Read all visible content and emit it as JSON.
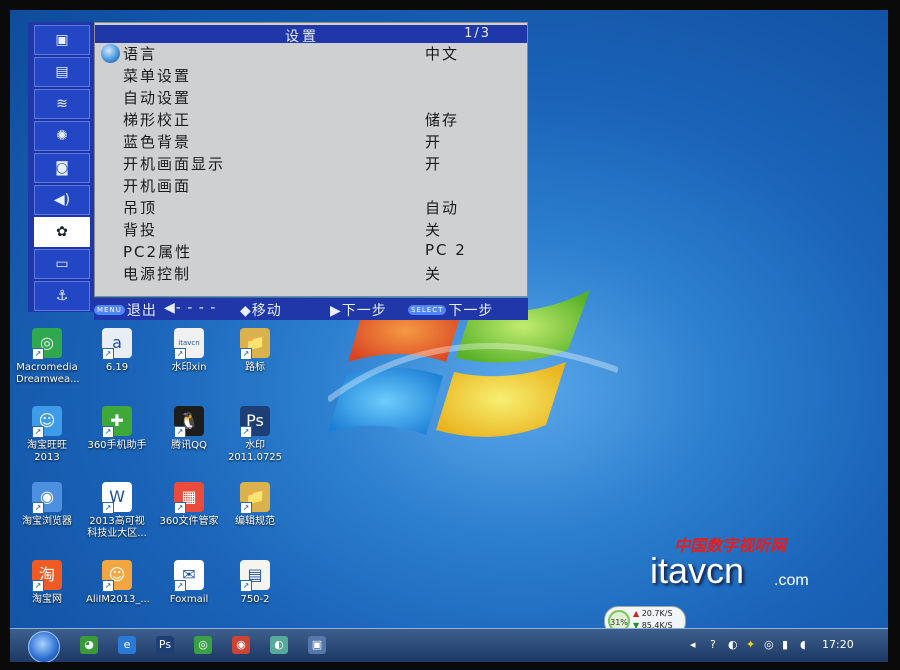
{
  "osd": {
    "title": "设置",
    "page": "1/3",
    "side_icons": [
      "image-icon",
      "display-icon",
      "waveform-icon",
      "brightness-icon",
      "projector-icon",
      "speaker-icon",
      "gear-icon",
      "monitor-icon",
      "anchor-icon"
    ],
    "active_index": 6,
    "menu": [
      {
        "label": "语言",
        "value": "中文"
      },
      {
        "label": "菜单设置",
        "value": ""
      },
      {
        "label": "自动设置",
        "value": ""
      },
      {
        "label": "梯形校正",
        "value": "储存"
      },
      {
        "label": "蓝色背景",
        "value": "开"
      },
      {
        "label": "开机画面显示",
        "value": "开"
      },
      {
        "label": "开机画面",
        "value": ""
      },
      {
        "label": "吊顶",
        "value": "自动"
      },
      {
        "label": "背投",
        "value": "关"
      },
      {
        "label": "PC2属性",
        "value": "PC 2"
      },
      {
        "label": "电源控制",
        "value": "关"
      }
    ],
    "footer": {
      "menu_btn": "MENU",
      "exit": "退出",
      "left": "◀- - - -",
      "move": "◆移动",
      "next_arrow": "▶下一步",
      "select_btn": "SELECT",
      "next2": "下一步"
    }
  },
  "desktop": {
    "icons": [
      {
        "label": "Macromedia Dreamwea...",
        "color": "#2fa84f",
        "glyph": "◎"
      },
      {
        "label": "6.19",
        "color": "#e9eef5",
        "glyph": "a"
      },
      {
        "label": "水印xin",
        "color": "#f1f1f1",
        "glyph": "itavcn"
      },
      {
        "label": "路标",
        "color": "#d9b24e",
        "glyph": "📁"
      },
      {
        "label": "淘宝旺旺 2013",
        "color": "#3e9be8",
        "glyph": "☺"
      },
      {
        "label": "360手机助手",
        "color": "#3fa83a",
        "glyph": "✚"
      },
      {
        "label": "腾讯QQ",
        "color": "#1d1d1d",
        "glyph": "🐧"
      },
      {
        "label": "水印 2011.0725",
        "color": "#1d3f75",
        "glyph": "Ps"
      },
      {
        "label": "淘宝浏览器",
        "color": "#4d90e0",
        "glyph": "◉"
      },
      {
        "label": "2013高可视 科技业大区...",
        "color": "#ffffff",
        "glyph": "W"
      },
      {
        "label": "360文件管家",
        "color": "#e94c3c",
        "glyph": "▦"
      },
      {
        "label": "编辑规范",
        "color": "#d9b24e",
        "glyph": "📁"
      },
      {
        "label": "淘宝网",
        "color": "#f05a24",
        "glyph": "淘"
      },
      {
        "label": "AliIM2013_...",
        "color": "#f3a640",
        "glyph": "☺"
      },
      {
        "label": "Foxmail",
        "color": "#ffffff",
        "glyph": "✉"
      },
      {
        "label": "750-2",
        "color": "#f5f5f0",
        "glyph": "▤"
      }
    ]
  },
  "watermark": {
    "cn": "中国数字视听网",
    "main": "itavcn",
    "dot": ".com"
  },
  "netmeter": {
    "percent": "31%",
    "up": "20.7K/S",
    "down": "85.4K/S"
  },
  "taskbar": {
    "pinned": [
      {
        "name": "360-browser-icon",
        "glyph": "◕",
        "color": "#3a9a3a"
      },
      {
        "name": "ie-icon",
        "glyph": "e",
        "color": "#2b7ad8"
      },
      {
        "name": "photoshop-icon",
        "glyph": "Ps",
        "color": "#1d3f75"
      },
      {
        "name": "360-safe-icon",
        "glyph": "◎",
        "color": "#3aa045"
      },
      {
        "name": "chrome-icon",
        "glyph": "◉",
        "color": "#c43"
      },
      {
        "name": "app-icon",
        "glyph": "◐",
        "color": "#5a9"
      },
      {
        "name": "window-icon",
        "glyph": "▣",
        "color": "#5577aa"
      }
    ],
    "clock": "17:20"
  }
}
